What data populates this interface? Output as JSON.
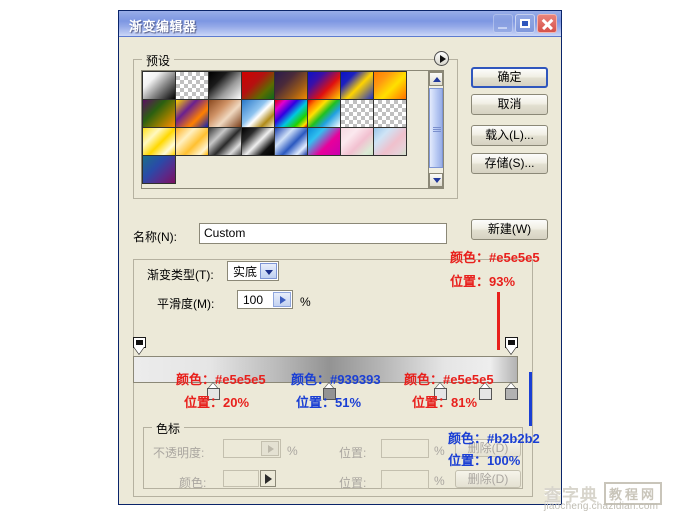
{
  "window": {
    "title": "渐变编辑器",
    "controls": {
      "minimize": "minimize-button",
      "maximize": "maximize-button",
      "close": "close-button"
    }
  },
  "preset": {
    "legend": "预设",
    "menu_icon": "preset-menu-arrow-icon",
    "swatches": [
      {
        "name": "foreground-to-background",
        "css": "linear-gradient(135deg,#ffffff 0%,#f2f2f2 28%,#8a8a8a 58%,#000000 100%)"
      },
      {
        "name": "foreground-to-transparent",
        "css": "checker"
      },
      {
        "name": "black-white",
        "css": "linear-gradient(135deg,#000000 0%,#1a1a1a 30%,#9a9a9a 62%,#ffffff 100%)"
      },
      {
        "name": "red-green",
        "css": "linear-gradient(135deg,#d00000 0%,#b51010 40%,#5c6b00 72%,#0c6a1e 100%)"
      },
      {
        "name": "violet-orange",
        "css": "linear-gradient(135deg,#2b1b4d 0%,#4a2a3a 35%,#9b5a18 70%,#f08a00 100%)"
      },
      {
        "name": "blue-red-yellow",
        "css": "linear-gradient(135deg,#0a12c8 0%,#3a10a8 28%,#e01010 62%,#ffd400 100%)"
      },
      {
        "name": "blue-yellow-blue",
        "css": "linear-gradient(135deg,#0a12c8 0%,#1b20c0 25%,#ffd400 55%,#2030c8 100%)"
      },
      {
        "name": "orange-yellow-orange",
        "css": "linear-gradient(135deg,#ff7a00 0%,#ff9a10 28%,#ffe000 58%,#ff7000 100%)"
      },
      {
        "name": "violet-green-orange",
        "css": "linear-gradient(135deg,#5a1060 0%,#2b6010 38%,#8a7a00 66%,#ff8c00 100%)"
      },
      {
        "name": "yellow-violet-orange-blue",
        "css": "linear-gradient(135deg,#ffd400 0%,#6a2090 35%,#ff8000 68%,#1020b0 100%)"
      },
      {
        "name": "copper",
        "css": "linear-gradient(135deg,#8a4a20 0%,#cf9266 35%,#f0d8c0 60%,#7a3d18 100%)"
      },
      {
        "name": "chrome",
        "css": "linear-gradient(135deg,#2a78c8 0%,#8fc4ef 42%,#ffffff 55%,#b08a18 78%,#f2e8c8 100%)"
      },
      {
        "name": "spectrum",
        "css": "linear-gradient(135deg,#e00000 0%,#e000d0 18%,#3000e0 38%,#00c8e0 58%,#20d000 78%,#ffe000 92%,#e00000 100%)"
      },
      {
        "name": "transparent-rainbow",
        "css": "linear-gradient(135deg,#e00000 0%,#ff8000 16%,#ffe000 32%,#20c020 50%,#20a0e0 68%,#ffffff 100%)"
      },
      {
        "name": "transparent-stripes",
        "css": "checker"
      },
      {
        "name": "transparent-gray",
        "css": "checker"
      },
      {
        "name": "yellow-white-stripes",
        "css": "linear-gradient(135deg,#ffe020 0%,#fff8c0 30%,#ffd800 55%,#fffbd8 80%,#ffd000 100%)"
      },
      {
        "name": "orange-cream",
        "css": "linear-gradient(135deg,#ffb020 0%,#fff0c0 32%,#ffc030 60%,#fff4d0 85%,#ffb400 100%)"
      },
      {
        "name": "steel-bar",
        "css": "linear-gradient(135deg,#3a3a3a 0%,#c8c8c8 30%,#2a2a2a 55%,#dcdcdc 80%,#4a4a4a 100%)"
      },
      {
        "name": "black-silver",
        "css": "linear-gradient(135deg,#000000 0%,#2a2a2a 25%,#f0f0f0 52%,#101010 78%,#000000 100%)"
      },
      {
        "name": "blue-steel",
        "css": "linear-gradient(135deg,#1a40b0 0%,#cfe0f8 32%,#2a58c0 58%,#e0ecff 82%,#1a3aa8 100%)"
      },
      {
        "name": "blue-pink",
        "css": "linear-gradient(135deg,#0a8ad8 0%,#30c0f0 28%,#e8009a 62%,#c800b0 100%)"
      },
      {
        "name": "pastel-pink-green",
        "css": "linear-gradient(135deg,#f6d8e2 0%,#fbe8ee 30%,#f2c0d0 58%,#dcead6 85%,#cfe4c8 100%)"
      },
      {
        "name": "pastel-blue-pink",
        "css": "linear-gradient(135deg,#9ac6ea 0%,#cfe4f6 28%,#f0c0cc 60%,#e8d0d8 82%,#cfe0c8 100%)"
      },
      {
        "name": "teal-violet",
        "css": "linear-gradient(135deg,#1b6e8a 0%,#2a4aa8 40%,#5a2a8a 70%,#7a1060 100%)"
      }
    ],
    "scrollbar": {
      "up": "scroll-up-arrow",
      "down": "scroll-down-arrow",
      "thumb": "scroll-thumb"
    }
  },
  "buttons": {
    "ok": "确定",
    "cancel": "取消",
    "load": "载入(L)...",
    "save": "存储(S)...",
    "new": "新建(W)"
  },
  "name_field": {
    "label": "名称(N):",
    "value": "Custom"
  },
  "gradient_type": {
    "label": "渐变类型(T):",
    "value": "实底"
  },
  "smoothness": {
    "label": "平滑度(M):",
    "value": "100",
    "unit": "%"
  },
  "gradient_bar": {
    "css": "linear-gradient(90deg,#ececec 0%,#e5e5e5 20%,#b9b9b9 38%,#939393 51%,#b4b4b4 64%,#e5e5e5 81%,#eeeeee 93%,#b2b2b2 100%)",
    "opacity_stops": [
      {
        "name": "opacity-stop-left",
        "position_pct": 0
      },
      {
        "name": "opacity-stop-right",
        "position_pct": 100
      }
    ],
    "color_stops": [
      {
        "name": "color-stop-1",
        "position_pct": 20,
        "color": "#e5e5e5"
      },
      {
        "name": "color-stop-2",
        "position_pct": 51,
        "color": "#939393"
      },
      {
        "name": "color-stop-3",
        "position_pct": 81,
        "color": "#e5e5e5"
      },
      {
        "name": "color-stop-4",
        "position_pct": 93,
        "color": "#e5e5e5"
      },
      {
        "name": "color-stop-5",
        "position_pct": 100,
        "color": "#b2b2b2"
      }
    ]
  },
  "stops_group": {
    "legend": "色标",
    "opacity_label": "不透明度:",
    "opacity_value": "",
    "opacity_unit": "%",
    "position_label_1": "位置:",
    "position_value_1": "",
    "position_unit_1": "%",
    "delete_label_1": "删除(D)",
    "color_label": "颜色:",
    "position_label_2": "位置:",
    "position_value_2": "",
    "position_unit_2": "%",
    "delete_label_2": "删除(D)"
  },
  "annotations": {
    "color_key": "颜色",
    "position_key": "位置",
    "items": [
      {
        "name": "annotation-stop-93",
        "color_text": "颜色：#e5e5e5",
        "position_text": "位置：93%",
        "style": "red"
      },
      {
        "name": "annotation-stop-20",
        "color_text": "颜色：#e5e5e5",
        "position_text": "位置：20%",
        "style": "red"
      },
      {
        "name": "annotation-stop-51",
        "color_text": "颜色：#939393",
        "position_text": "位置：51%",
        "style": "blue"
      },
      {
        "name": "annotation-stop-81",
        "color_text": "颜色：#e5e5e5",
        "position_text": "位置：81%",
        "style": "red"
      },
      {
        "name": "annotation-stop-100",
        "color_text": "颜色：#b2b2b2",
        "position_text": "位置：100%",
        "style": "blue"
      }
    ]
  },
  "watermark": {
    "main": "查字典",
    "box": "教程网",
    "url": "jiaocheng.chazidian.com"
  }
}
